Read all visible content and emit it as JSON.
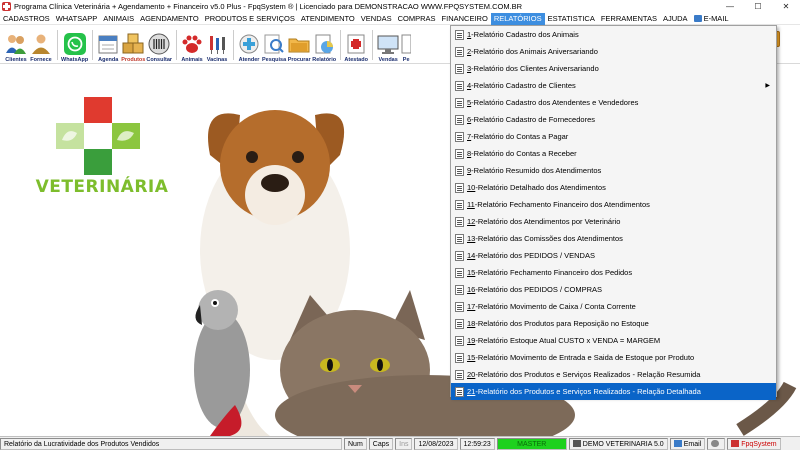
{
  "window": {
    "title": "Programa Clínica Veterinária + Agendamento + Financeiro v5.0 Plus - FpqSystem ® | Licenciado para  DEMONSTRACAO WWW.FPQSYSTEM.COM.BR",
    "minimize": "—",
    "maximize": "☐",
    "close": "✕"
  },
  "menubar": [
    "CADASTROS",
    "WHATSAPP",
    "ANIMAIS",
    "AGENDAMENTO",
    "PRODUTOS E SERVIÇOS",
    "ATENDIMENTO",
    "VENDAS",
    "COMPRAS",
    "FINANCEIRO",
    "RELATÓRIOS",
    "ESTATISTICA",
    "FERRAMENTAS",
    "AJUDA",
    "E-MAIL"
  ],
  "toolbar": [
    {
      "label": "Clientes",
      "icon": "people-icon"
    },
    {
      "label": "Fornece",
      "icon": "supplier-icon"
    },
    {
      "label": "WhatsApp",
      "icon": "whatsapp-icon"
    },
    {
      "label": "Agenda",
      "icon": "calendar-icon"
    },
    {
      "label": "Produtos",
      "icon": "boxes-icon"
    },
    {
      "label": "Consultar",
      "icon": "barcode-icon"
    },
    {
      "label": "Animais",
      "icon": "paw-icon"
    },
    {
      "label": "Vacinas",
      "icon": "syringe-icon"
    },
    {
      "label": "Atender",
      "icon": "medical-icon"
    },
    {
      "label": "Pesquisa",
      "icon": "search-icon"
    },
    {
      "label": "Procurar",
      "icon": "folder-icon"
    },
    {
      "label": "Relatório",
      "icon": "report-icon"
    },
    {
      "label": "Atestado",
      "icon": "certificate-icon"
    },
    {
      "label": "Vendas",
      "icon": "monitor-icon"
    },
    {
      "label": "Pe",
      "icon": "order-icon"
    }
  ],
  "logo": {
    "text": "VETERINÁRIA",
    "colors": {
      "red": "#e03a2f",
      "green": "#3a9e3c",
      "light_green": "#8cc63f"
    }
  },
  "dropdown": {
    "items": [
      {
        "num": "1",
        "label": "-Relatório Cadastro dos Animais"
      },
      {
        "num": "2",
        "label": "-Relatório dos Animais Aniversariando"
      },
      {
        "num": "3",
        "label": "-Relatório dos Clientes Aniversariando"
      },
      {
        "num": "4",
        "label": "-Relatório Cadastro de Clientes",
        "submenu": "▶"
      },
      {
        "num": "5",
        "label": "-Relatório Cadastro dos Atendentes e Vendedores"
      },
      {
        "num": "6",
        "label": "-Relatório Cadastro de Fornecedores"
      },
      {
        "num": "7",
        "label": "-Relatório do Contas a Pagar"
      },
      {
        "num": "8",
        "label": "-Relatório do Contas a Receber"
      },
      {
        "num": "9",
        "label": "-Relatório Resumido dos Atendimentos"
      },
      {
        "num": "10",
        "label": "-Relatório Detalhado dos Atendimentos"
      },
      {
        "num": "11",
        "label": "-Relatório Fechamento Financeiro dos Atendimentos"
      },
      {
        "num": "12",
        "label": "-Relatório dos Atendimentos por Veterinário"
      },
      {
        "num": "13",
        "label": "-Relatório das Comissões dos Atendimentos"
      },
      {
        "num": "14",
        "label": "-Relatório dos PEDIDOS / VENDAS"
      },
      {
        "num": "15",
        "label": "-Relatório Fechamento Financeiro dos Pedidos"
      },
      {
        "num": "16",
        "label": "-Relatório dos PEDIDOS / COMPRAS"
      },
      {
        "num": "17",
        "label": "-Relatório Movimento de Caixa / Conta Corrente"
      },
      {
        "num": "18",
        "label": "-Relatório dos Produtos para Reposição no Estoque"
      },
      {
        "num": "19",
        "label": "-Relatório Estoque Atual CUSTO x VENDA = MARGEM"
      },
      {
        "num": "15",
        "label": "-Relatório Movimento de Entrada e Saida de Estoque por Produto"
      },
      {
        "num": "20",
        "label": "-Relatório dos Produtos e Serviços Realizados - Relação Resumida"
      },
      {
        "num": "21",
        "label": "-Relatório dos Produtos e Serviços Realizados - Relação Detalhada",
        "highlighted": true
      }
    ]
  },
  "statusbar": {
    "message": "Relatório da Lucratividade dos Produtos Vendidos",
    "num": "Num",
    "caps": "Caps",
    "ins": "Ins",
    "date": "12/08/2023",
    "time": "12:59:23",
    "license": "MASTER",
    "database": "DEMO VETERINARIA 5.0",
    "email": "Email",
    "brand": "FpqSystem",
    "colors": {
      "master_bg": "#1ed11e",
      "highlight": "#0a64c8"
    }
  }
}
